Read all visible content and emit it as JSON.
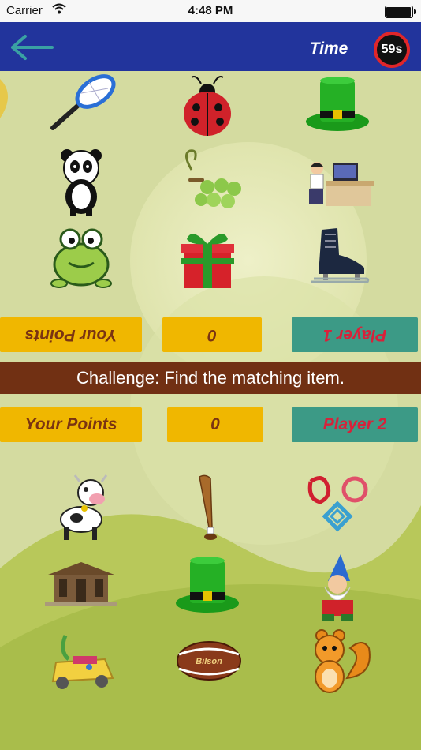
{
  "status_bar": {
    "carrier": "Carrier",
    "time": "4:48 PM"
  },
  "header": {
    "time_label": "Time",
    "timer": "59s"
  },
  "player1": {
    "points_label": "Your Points",
    "points": "0",
    "name": "Player 1"
  },
  "challenge": "Challenge: Find the matching item.",
  "player2": {
    "points_label": "Your Points",
    "points": "0",
    "name": "Player 2"
  },
  "top_grid": [
    "tennis-racket",
    "ladybug",
    "green-top-hat",
    "panda",
    "grapes",
    "person-at-computer",
    "frog",
    "gift-box",
    "ice-skate"
  ],
  "bottom_grid": [
    "cow",
    "baseball-bat",
    "flower-cookie-cutters",
    "pagoda-house",
    "green-top-hat",
    "garden-gnome",
    "toy-car",
    "football",
    "squirrel"
  ],
  "colors": {
    "navbar": "#22349c",
    "gold": "#f0b700",
    "teal": "#3c9a86",
    "challenge_bar": "#713013",
    "timer_ring": "#e0262a"
  }
}
